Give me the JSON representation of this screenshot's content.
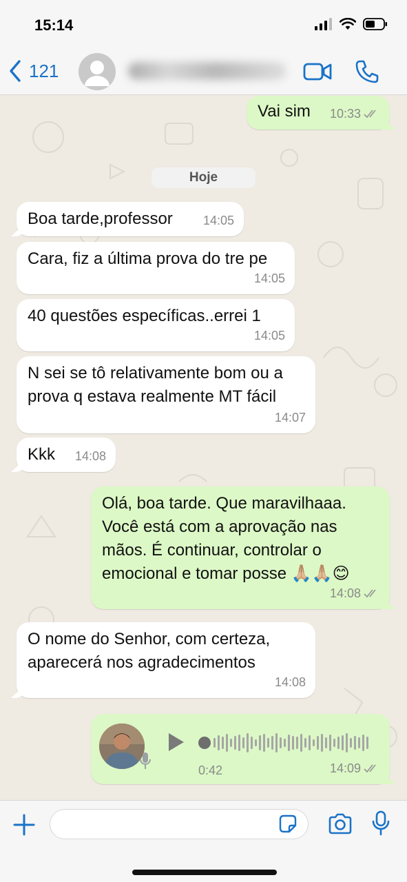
{
  "status_bar": {
    "time": "15:14"
  },
  "header": {
    "back_count": "121"
  },
  "chat": {
    "date_label": "Hoje",
    "messages": [
      {
        "text": "Vai sim",
        "time": "10:33"
      },
      {
        "text": "Boa tarde,professor",
        "time": "14:05"
      },
      {
        "text": "Cara, fiz a última prova do tre pe",
        "time": "14:05"
      },
      {
        "text": "40 questões específicas..errei 1",
        "time": "14:05"
      },
      {
        "line1": "N sei se tô relativamente bom ou a",
        "line2": "prova q estava realmente MT fácil",
        "time": "14:07"
      },
      {
        "text": "Kkk",
        "time": "14:08"
      },
      {
        "line1": "Olá, boa tarde. Que maravilhaaa.",
        "line2": "Você está com a aprovação nas",
        "line3": "mãos. É continuar, controlar o",
        "line4": "emocional e tomar posse 🙏🏼🙏🏼😊",
        "time": "14:08"
      },
      {
        "line1": "O nome do Senhor, com certeza,",
        "line2": "aparecerá nos agradecimentos",
        "time": "14:08"
      }
    ],
    "voice_note": {
      "duration": "0:42",
      "time": "14:09"
    }
  },
  "icons": {
    "back": "chevron-left-icon",
    "video": "video-camera-icon",
    "call": "phone-icon",
    "add": "plus-icon",
    "sticker": "sticker-icon",
    "camera": "camera-icon",
    "mic": "microphone-icon"
  },
  "colors": {
    "accent": "#1a73c8",
    "outgoing": "#dcf8c6",
    "incoming": "#ffffff",
    "background": "#efeae2"
  }
}
